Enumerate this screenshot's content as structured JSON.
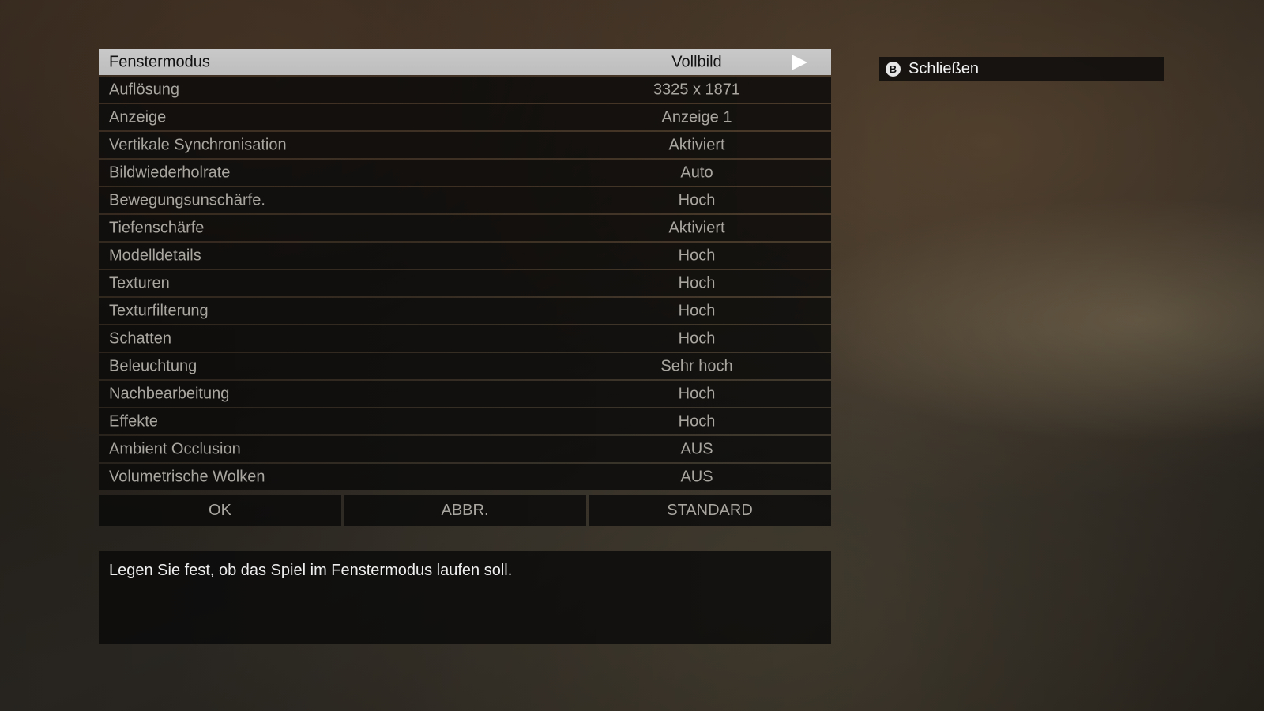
{
  "settings": [
    {
      "label": "Fenstermodus",
      "value": "Vollbild"
    },
    {
      "label": "Auflösung",
      "value": "3325 x 1871"
    },
    {
      "label": "Anzeige",
      "value": "Anzeige 1"
    },
    {
      "label": "Vertikale Synchronisation",
      "value": "Aktiviert"
    },
    {
      "label": "Bildwiederholrate",
      "value": "Auto"
    },
    {
      "label": "Bewegungsunschärfe.",
      "value": "Hoch"
    },
    {
      "label": "Tiefenschärfe",
      "value": "Aktiviert"
    },
    {
      "label": "Modelldetails",
      "value": "Hoch"
    },
    {
      "label": "Texturen",
      "value": "Hoch"
    },
    {
      "label": "Texturfilterung",
      "value": "Hoch"
    },
    {
      "label": "Schatten",
      "value": "Hoch"
    },
    {
      "label": "Beleuchtung",
      "value": "Sehr hoch"
    },
    {
      "label": "Nachbearbeitung",
      "value": "Hoch"
    },
    {
      "label": "Effekte",
      "value": "Hoch"
    },
    {
      "label": "Ambient Occlusion",
      "value": "AUS"
    },
    {
      "label": "Volumetrische Wolken",
      "value": "AUS"
    }
  ],
  "selected_index": 0,
  "buttons": {
    "ok": "OK",
    "cancel": "ABBR.",
    "default": "STANDARD"
  },
  "description": "Legen Sie fest, ob das Spiel im Fenstermodus laufen soll.",
  "close_hint": {
    "button_glyph": "B",
    "label": "Schließen"
  },
  "icons": {
    "selected_row_arrow": "right-arrow-icon",
    "close_button": "b-button-icon"
  },
  "colors": {
    "selected_row_bg": "#c4c4c4",
    "row_bg": "#0a0a0a",
    "row_text": "#a9a6a0",
    "highlight_text": "#eeeeee"
  }
}
